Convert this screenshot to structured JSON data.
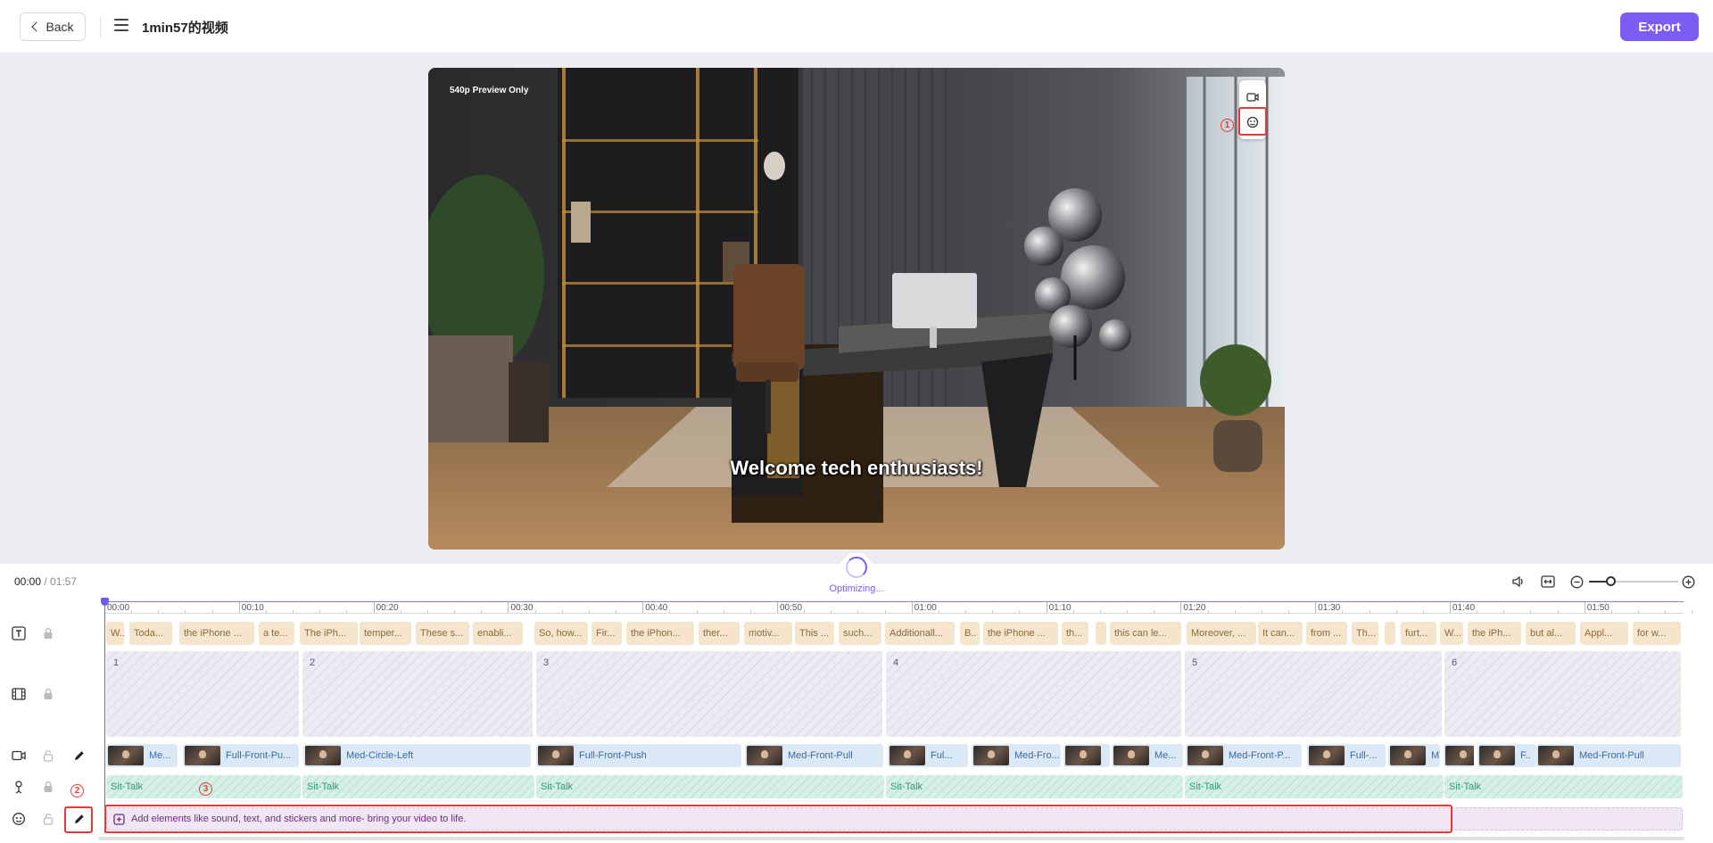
{
  "header": {
    "back_label": "Back",
    "title": "1min57的视频",
    "export_label": "Export"
  },
  "preview": {
    "quality_label": "540p Preview Only",
    "caption": "Welcome tech enthusiasts!",
    "tools": [
      "camera-icon",
      "sticker-icon"
    ]
  },
  "annotations": {
    "n1": "1",
    "n2": "2",
    "n3": "3"
  },
  "player": {
    "current_time": "00:00",
    "separator": " / ",
    "total_time": "01:57",
    "status": "Optimizing..."
  },
  "ruler": {
    "labels": [
      "00:00",
      "00:10",
      "00:20",
      "00:30",
      "00:40",
      "00:50",
      "01:00",
      "01:10",
      "01:20",
      "01:30",
      "01:40",
      "01:50"
    ]
  },
  "tracks": {
    "text_clips": [
      "W..",
      "Toda...",
      "the iPhone ...",
      "a te...",
      "The iPh...",
      "temper...",
      "These s...",
      "enabli...",
      "So, how...",
      "Fir...",
      "the iPhon...",
      "ther...",
      "motiv...",
      "This ...",
      "such...",
      "Additionall...",
      "B..",
      "the iPhone ...",
      "th...",
      "",
      "this can le...",
      "Moreover, ...",
      "It can...",
      "from ...",
      "Th...",
      "",
      "furt...",
      "W...",
      "the iPh...",
      "but al...",
      "Appl...",
      "for w..."
    ],
    "scene_clips": [
      "1",
      "2",
      "3",
      "4",
      "5",
      "6"
    ],
    "video_clips": [
      "Me...",
      "Full-Front-Pu...",
      "Med-Circle-Left",
      "Full-Front-Push",
      "Med-Front-Pull",
      "Ful...",
      "Med-Fro...",
      "",
      "Me...",
      "Med-Front-P...",
      "Full-...",
      "M",
      "",
      "F..",
      "Med-Front-Pull"
    ],
    "avatar_clips": [
      "Sit-Talk",
      "Sit-Talk",
      "Sit-Talk",
      "Sit-Talk",
      "Sit-Talk",
      "Sit-Talk"
    ],
    "elements_hint": "Add elements like sound, text, and stickers and more- bring your video to life."
  },
  "colors": {
    "accent": "#7b5cf5",
    "annotation": "#e53935",
    "text_track": "#f4e5cc",
    "video_track": "#dbe9f6",
    "avatar_track": "#d6f0e6",
    "elements_track": "#f1e6f4"
  }
}
